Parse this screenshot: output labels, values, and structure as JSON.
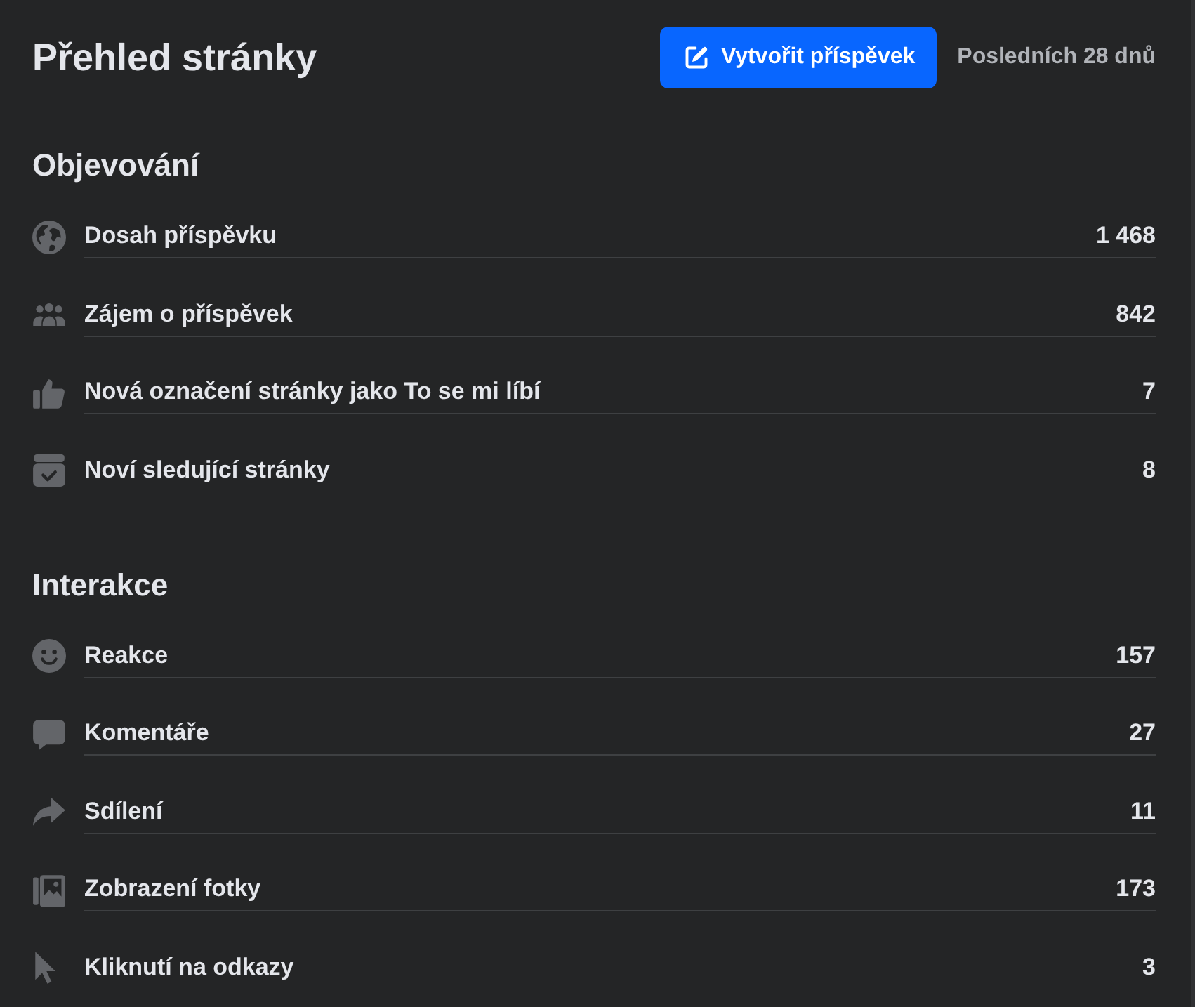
{
  "header": {
    "title": "Přehled stránky",
    "create_button": "Vytvořit příspěvek",
    "period": "Posledních 28 dnů"
  },
  "sections": [
    {
      "title": "Objevování",
      "rows": [
        {
          "label": "Dosah příspěvku",
          "value": "1 468"
        },
        {
          "label": "Zájem o příspěvek",
          "value": "842"
        },
        {
          "label": "Nová označení stránky jako To se mi líbí",
          "value": "7"
        },
        {
          "label": "Noví sledující stránky",
          "value": "8"
        }
      ]
    },
    {
      "title": "Interakce",
      "rows": [
        {
          "label": "Reakce",
          "value": "157"
        },
        {
          "label": "Komentáře",
          "value": "27"
        },
        {
          "label": "Sdílení",
          "value": "11"
        },
        {
          "label": "Zobrazení fotky",
          "value": "173"
        },
        {
          "label": "Kliknutí na odkazy",
          "value": "3"
        }
      ]
    }
  ]
}
